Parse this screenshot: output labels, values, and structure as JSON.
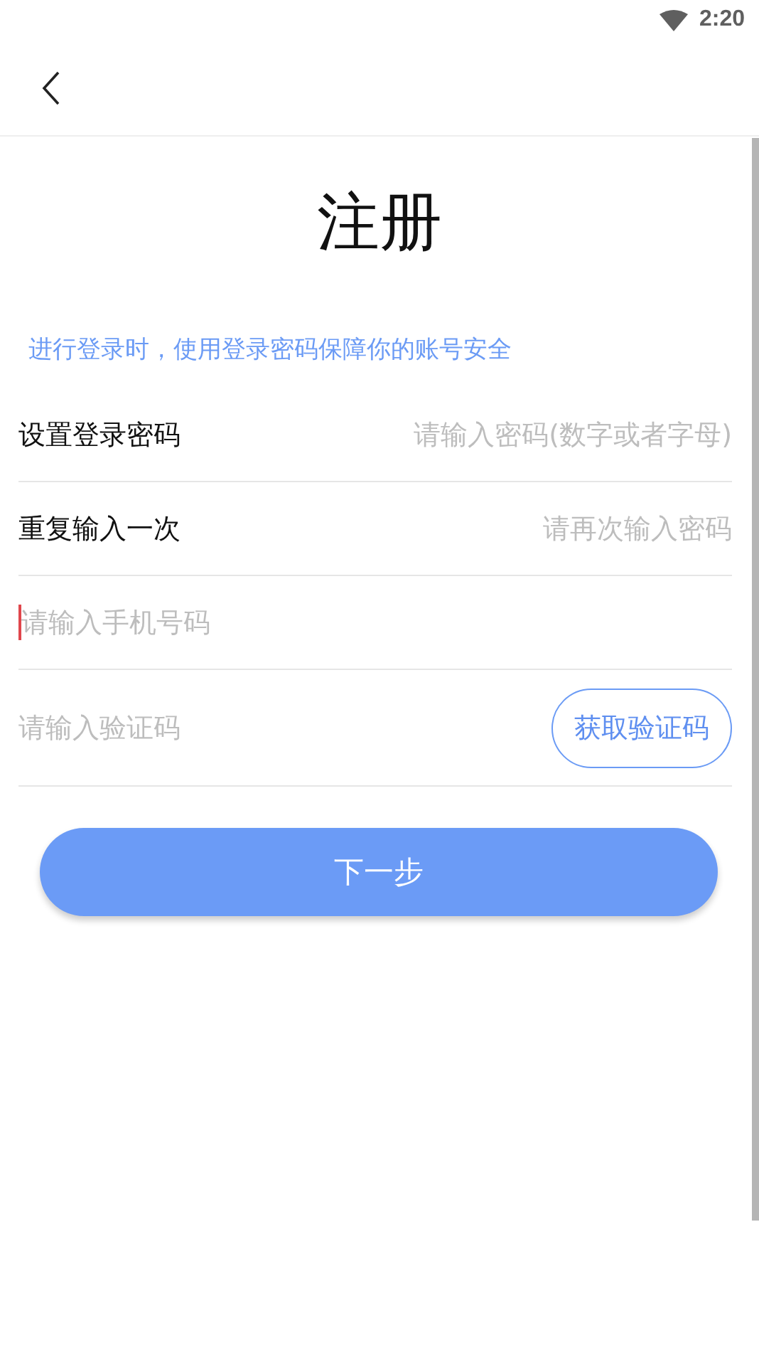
{
  "status_bar": {
    "time": "2:20"
  },
  "title": "注册",
  "hint": "进行登录时，使用登录密码保障你的账号安全",
  "fields": [
    {
      "kind": "labeled",
      "label": "设置登录密码",
      "placeholder": "请输入密码(数字或者字母)",
      "focused": false
    },
    {
      "kind": "labeled",
      "label": "重复输入一次",
      "placeholder": "请再次输入密码",
      "focused": false
    },
    {
      "kind": "plain",
      "placeholder": "请输入手机号码",
      "focused": true
    },
    {
      "kind": "code",
      "placeholder": "请输入验证码",
      "button": "获取验证码",
      "focused": false
    }
  ],
  "next_button": "下一步"
}
